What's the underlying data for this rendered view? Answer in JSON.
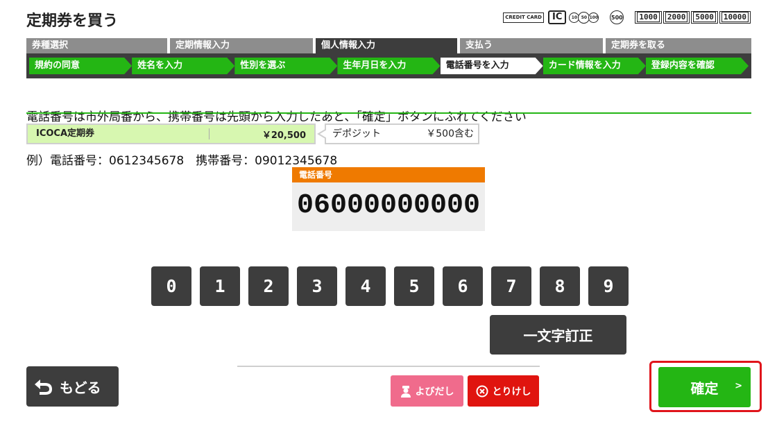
{
  "header": {
    "title": "定期券を買う",
    "payment": {
      "credit_card": "CREDIT CARD",
      "ic": "IC",
      "coins": [
        "10",
        "50",
        "100"
      ],
      "coin_500": "500",
      "notes": [
        "1000",
        "2000",
        "5000",
        "10000"
      ]
    }
  },
  "steps": [
    {
      "label": "券種選択",
      "state": "done"
    },
    {
      "label": "定期情報入力",
      "state": "done"
    },
    {
      "label": "個人情報入力",
      "state": "active"
    },
    {
      "label": "支払う",
      "state": "todo"
    },
    {
      "label": "定期券を取る",
      "state": "todo"
    }
  ],
  "substeps": [
    {
      "label": "規約の同意"
    },
    {
      "label": "姓名を入力"
    },
    {
      "label": "性別を選ぶ"
    },
    {
      "label": "生年月日を入力"
    },
    {
      "label": "電話番号を入力",
      "current": true
    },
    {
      "label": "カード情報を入力"
    },
    {
      "label": "登録内容を確認"
    }
  ],
  "instructions": {
    "line1": "電話番号は市外局番から、携帯番号は先頭から入力したあと、「確定」ボタンにふれてください",
    "line2": "例）電話番号：0612345678　携帯番号：09012345678"
  },
  "ticket": {
    "name": "ICOCA定期券",
    "price": "￥20,500",
    "deposit_label": "デポジット",
    "deposit_value": "￥500含む"
  },
  "phone": {
    "label": "電話番号",
    "value": "06000000000"
  },
  "keypad": {
    "keys": [
      "0",
      "1",
      "2",
      "3",
      "4",
      "5",
      "6",
      "7",
      "8",
      "9"
    ],
    "correct_label": "一文字訂正"
  },
  "footer": {
    "back_label": "もどる",
    "call_label": "よびだし",
    "cancel_label": "とりけし",
    "confirm_label": "確定",
    "confirm_arrow": ">"
  },
  "colors": {
    "accent_green": "#24b614",
    "dark": "#3d3d3d",
    "orange": "#ef7a00",
    "call_pink": "#f06b8c",
    "cancel_red": "#e0140f",
    "highlight_red": "#e0141b"
  }
}
